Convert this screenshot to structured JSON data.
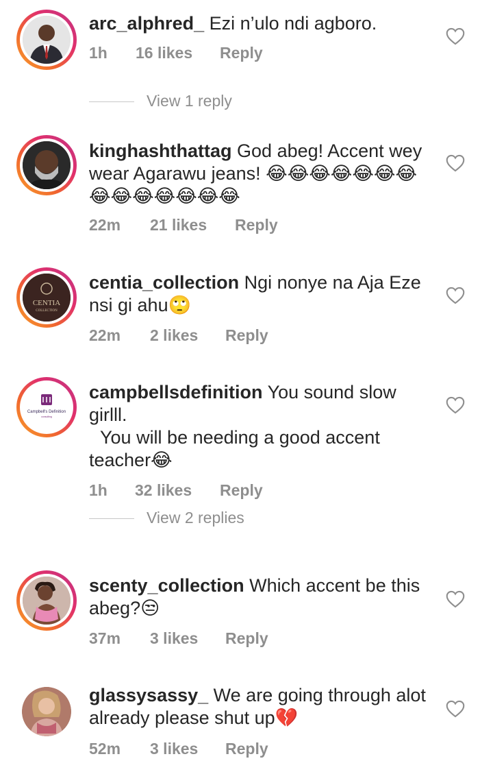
{
  "comments": [
    {
      "username": "arc_alphred_",
      "text": "Ezi n’ulo ndi agboro.",
      "time": "1h",
      "likes": "16 likes",
      "reply": "Reply"
    },
    {
      "username": "kinghashthattag",
      "text": "God abeg! Accent wey wear Agarawu jeans! 😂😂😂😂😂😂😂😂😂😂😂😂😂😂",
      "time": "22m",
      "likes": "21 likes",
      "reply": "Reply"
    },
    {
      "username": "centia_collection",
      "text": "Ngi nonye na Aja Eze nsi gi ahu🙄",
      "time": "22m",
      "likes": "2 likes",
      "reply": "Reply",
      "avatar_text": "CENTIA COLLECTION"
    },
    {
      "username": "campbellsdefinition",
      "text": "You sound slow girlll.",
      "text2": "You will be needing a good accent teacher😂",
      "time": "1h",
      "likes": "32 likes",
      "reply": "Reply",
      "avatar_text": "Campbell's Definition"
    },
    {
      "username": "scenty_collection",
      "text": "Which accent be this abeg?😒",
      "time": "37m",
      "likes": "3 likes",
      "reply": "Reply"
    },
    {
      "username": "glassysassy_",
      "text": "We are going through alot already please shut up💔",
      "time": "52m",
      "likes": "3 likes",
      "reply": "Reply"
    }
  ],
  "view_replies": [
    "View 1 reply",
    "View 2 replies"
  ],
  "icons": {
    "like": "heart-outline-icon"
  },
  "colors": {
    "meta": "#8e8e8e",
    "text": "#262626",
    "ring_start": "#f9a12e",
    "ring_end": "#c13584"
  }
}
